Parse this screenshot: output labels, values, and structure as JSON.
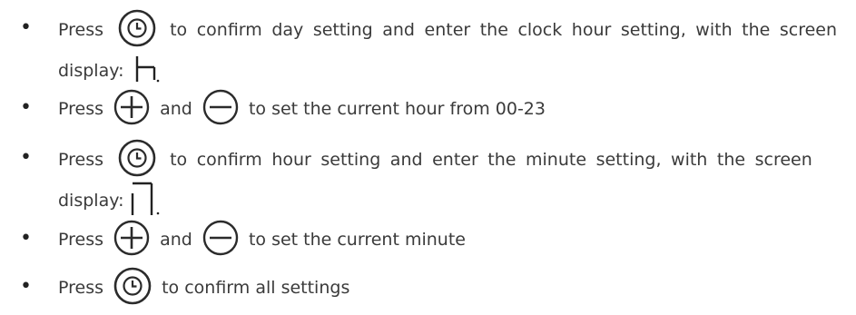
{
  "items": [
    {
      "press": "Press",
      "text_line1": "to confirm day setting and enter the clock hour setting, with the screen",
      "text_line2": "display:",
      "icons": [
        "clock-icon"
      ],
      "display_symbol": "hour-display-symbol"
    },
    {
      "press": "Press",
      "and": "and",
      "text_line1": "to set the current hour from 00-23",
      "icons": [
        "plus-icon",
        "minus-icon"
      ]
    },
    {
      "press": "Press",
      "text_line1": "to confirm hour setting and enter the minute setting, with the screen",
      "text_line2": "display:",
      "icons": [
        "clock-icon"
      ],
      "display_symbol": "minute-display-symbol"
    },
    {
      "press": "Press",
      "and": "and",
      "text_line1": "to set the current minute",
      "icons": [
        "plus-icon",
        "minus-icon"
      ]
    },
    {
      "press": "Press",
      "text_line1": "to confirm all settings",
      "icons": [
        "clock-icon"
      ]
    }
  ],
  "bullet_char": "•",
  "colors": {
    "text": "#3a3a3a",
    "icon_stroke": "#2b2b2b"
  }
}
